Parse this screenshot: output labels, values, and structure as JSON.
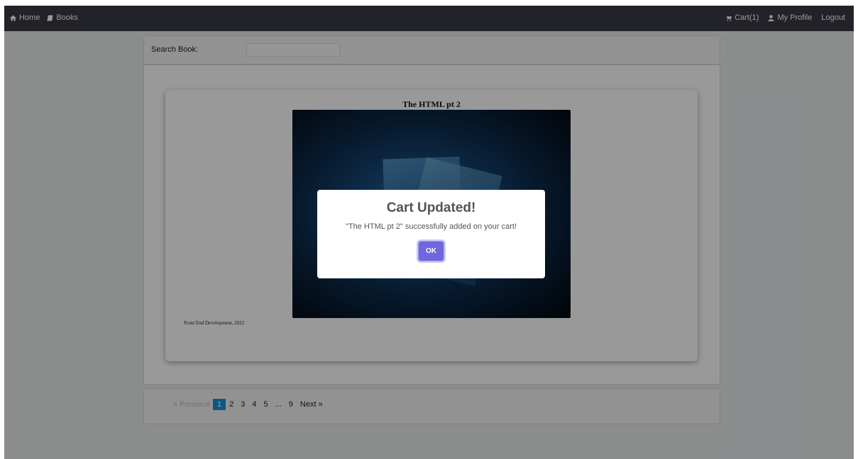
{
  "nav": {
    "home": "Home",
    "books": "Books",
    "cart": "Cart(1)",
    "profile": "My Profile",
    "logout": "Logout"
  },
  "search": {
    "label": "Search Book:",
    "value": ""
  },
  "book": {
    "title": "The HTML pt 2",
    "meta": "Front End Development, 2022"
  },
  "pagination": {
    "prev": "« Previous",
    "pages": [
      "1",
      "2",
      "3",
      "4",
      "5",
      "...",
      "9"
    ],
    "next": "Next »",
    "current": "1"
  },
  "modal": {
    "title": "Cart Updated!",
    "message": "\"The HTML pt 2\" successfully added on your cart!",
    "ok": "OK"
  },
  "colors": {
    "navbar": "#3a3a45",
    "active_page": "#1d8fd9",
    "ok_button": "#7066e0"
  }
}
